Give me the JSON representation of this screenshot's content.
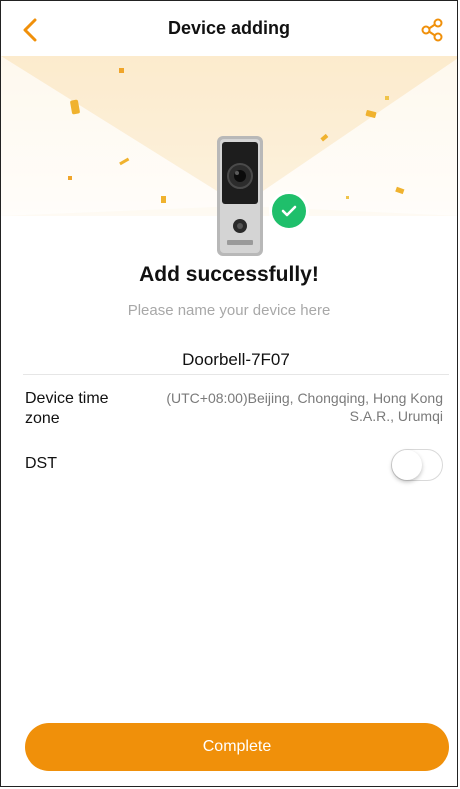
{
  "header": {
    "title": "Device adding",
    "back_icon": "chevron-left-icon",
    "share_icon": "share-icon",
    "accent_color": "#f0900a"
  },
  "result": {
    "message": "Add successfully!",
    "badge_icon": "checkmark-icon",
    "badge_color": "#1fbf6b"
  },
  "device_name": {
    "placeholder": "Please name your device here",
    "value": "Doorbell-7F07"
  },
  "settings": {
    "time_zone_label": "Device time zone",
    "time_zone_value": "(UTC+08:00)Beijing, Chongqing, Hong Kong S.A.R., Urumqi",
    "dst_label": "DST",
    "dst_enabled": false
  },
  "footer": {
    "complete_label": "Complete",
    "button_color": "#f0900a"
  }
}
